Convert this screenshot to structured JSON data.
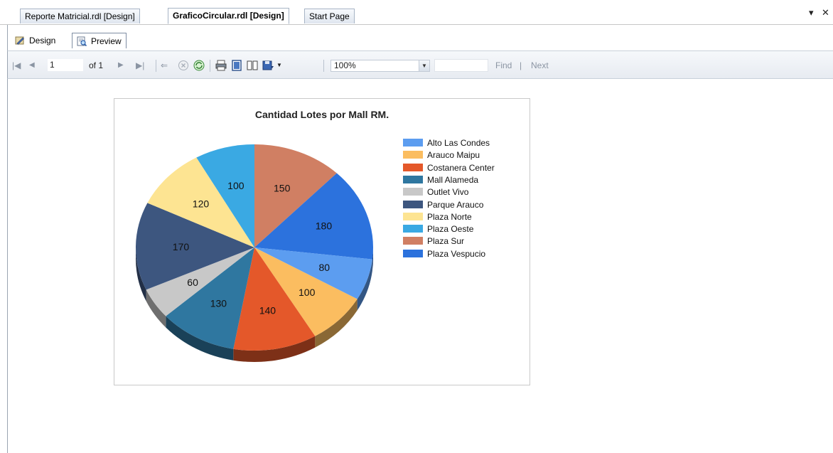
{
  "tabs": {
    "items": [
      {
        "label": "Reporte Matricial.rdl [Design]"
      },
      {
        "label": "GraficoCircular.rdl [Design]"
      },
      {
        "label": "Start Page"
      }
    ],
    "window_controls": {
      "pin": "▾",
      "close": "✕"
    }
  },
  "design_tabs": {
    "design_label": "Design",
    "preview_label": "Preview"
  },
  "toolbar": {
    "page_number": "1",
    "page_of": "of 1",
    "zoom": "100%",
    "find_label": "Find",
    "divider": "|",
    "next_label": "Next"
  },
  "chart_data": {
    "type": "pie",
    "title": "Cantidad Lotes por Mall RM.",
    "legend_position": "right",
    "slices": [
      {
        "name": "Alto Las Condes",
        "value": 80,
        "color": "#5c9df0"
      },
      {
        "name": "Arauco Maipu",
        "value": 100,
        "color": "#fbbd60"
      },
      {
        "name": "Costanera Center",
        "value": 140,
        "color": "#e4582a"
      },
      {
        "name": "Mall Alameda",
        "value": 130,
        "color": "#2f77a0"
      },
      {
        "name": "Outlet Vivo",
        "value": 60,
        "color": "#c8c8c8"
      },
      {
        "name": "Parque Arauco",
        "value": 170,
        "color": "#3d567f"
      },
      {
        "name": "Plaza Norte",
        "value": 120,
        "color": "#fde492"
      },
      {
        "name": "Plaza Oeste",
        "value": 100,
        "color": "#3aa9e3"
      },
      {
        "name": "Plaza Sur",
        "value": 150,
        "color": "#d07f63"
      },
      {
        "name": "Plaza Vespucio",
        "value": 180,
        "color": "#2c72dd"
      }
    ]
  }
}
